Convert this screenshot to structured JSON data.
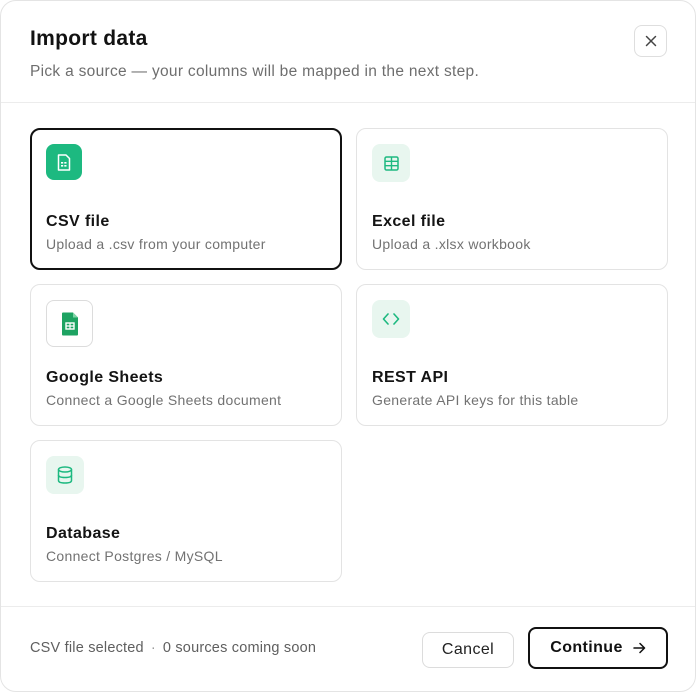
{
  "dialog": {
    "title": "Import data",
    "subtitle": "Pick a source — your columns will be mapped in the next step.",
    "close_icon": "close-icon"
  },
  "sources": [
    {
      "name": "CSV file",
      "description": "Upload a .csv from your computer",
      "icon": "csv-file-icon",
      "selected": true
    },
    {
      "name": "Excel file",
      "description": "Upload a .xlsx workbook",
      "icon": "spreadsheet-grid-icon",
      "selected": false
    },
    {
      "name": "Google Sheets",
      "description": "Connect a Google Sheets document",
      "icon": "google-sheets-icon",
      "selected": false
    },
    {
      "name": "REST API",
      "description": "Generate API keys for this table",
      "icon": "code-brackets-icon",
      "selected": false
    },
    {
      "name": "Database",
      "description": "Connect Postgres / MySQL",
      "icon": "database-icon",
      "selected": false
    }
  ],
  "footer": {
    "selection_status": "CSV file selected",
    "separator": "·",
    "coming_soon": "0 sources coming soon",
    "cancel_label": "Cancel",
    "continue_label": "Continue"
  },
  "colors": {
    "accent_green": "#1db980",
    "mint_tile": "#e8f6ef",
    "sheets_green": "#1ea362",
    "selected_border": "#111111"
  }
}
